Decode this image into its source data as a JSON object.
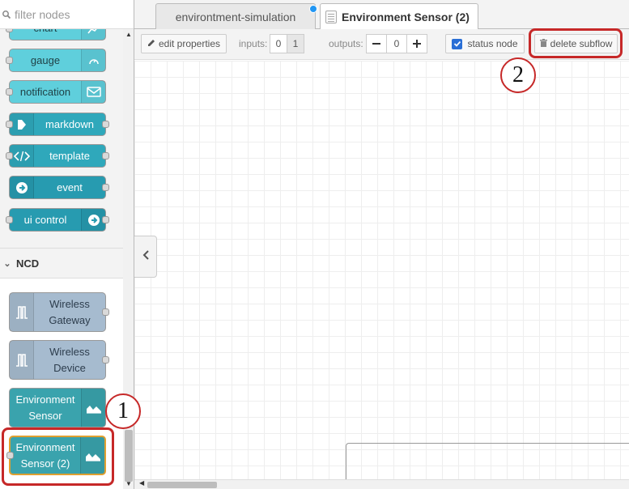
{
  "palette": {
    "filter_placeholder": "filter nodes",
    "nodes_top": [
      {
        "label": "chart",
        "icon": "chart-icon"
      },
      {
        "label": "gauge",
        "icon": "gauge-icon"
      },
      {
        "label": "notification",
        "icon": "envelope-icon"
      },
      {
        "label": "markdown",
        "icon": "markdown-icon"
      },
      {
        "label": "template",
        "icon": "code-icon"
      },
      {
        "label": "event",
        "icon": "arrow-right-icon"
      },
      {
        "label": "ui control",
        "icon": "arrow-right-icon"
      }
    ],
    "category": {
      "label": "NCD",
      "icon": "chevron-down-icon"
    },
    "nodes_ncd": [
      {
        "label": "Wireless Gateway",
        "icon": "wireless-icon"
      },
      {
        "label": "Wireless Device",
        "icon": "wireless-icon"
      },
      {
        "label": "Environment Sensor",
        "icon": "area-chart-icon"
      },
      {
        "label": "Environment Sensor (2)",
        "icon": "area-chart-icon"
      }
    ]
  },
  "tabs": [
    {
      "label": "environtment-simulation",
      "modified": true
    },
    {
      "label": "Environment Sensor (2)",
      "active": true,
      "icon": "subflow-icon"
    }
  ],
  "toolbar": {
    "edit_label": "edit properties",
    "inputs_label": "inputs:",
    "inputs_options": [
      "0",
      "1"
    ],
    "outputs_label": "outputs:",
    "outputs_value": "0",
    "status_label": "status node",
    "delete_label": "delete subflow"
  },
  "annotations": {
    "callout_1": "1",
    "callout_2": "2"
  },
  "colors": {
    "accent": "#2196f3",
    "highlight": "#c62828",
    "ui_node": "#5fcfdc",
    "ncd_node": "#a6bbcf",
    "env_node": "#3aa3ad"
  }
}
